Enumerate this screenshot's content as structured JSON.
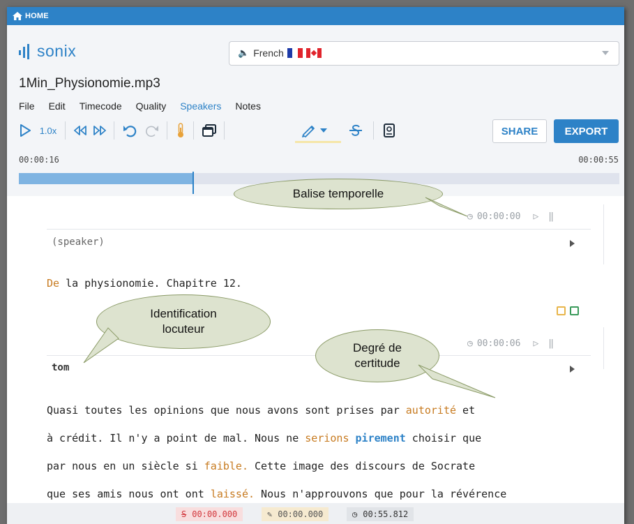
{
  "topbar": {
    "home_label": "HOME",
    "home_icon": "home-icon"
  },
  "brand": {
    "logo_text": "sonix"
  },
  "language": {
    "label": "French",
    "icon": "speaker-icon"
  },
  "file": {
    "name": "1Min_Physionomie.mp3"
  },
  "menu": {
    "items": [
      "File",
      "Edit",
      "Timecode",
      "Quality",
      "Speakers",
      "Notes"
    ]
  },
  "toolbar": {
    "speed": "1.0x",
    "share_label": "SHARE",
    "export_label": "EXPORT"
  },
  "player": {
    "current_time": "00:00:16",
    "total_time": "00:00:55",
    "progress": 0.29
  },
  "annotations": {
    "timestamp_balloon": "Balise temporelle",
    "speaker_balloon_1": "Identification",
    "speaker_balloon_2": "locuteur",
    "certainty_balloon_1": "Degré de",
    "certainty_balloon_2": "certitude"
  },
  "transcript": {
    "block1": {
      "time": "00:00:00",
      "speaker": "(speaker)",
      "text_first": "De",
      "text_rest": " la physionomie. Chapitre 12."
    },
    "block2": {
      "time": "00:00:06",
      "speaker": "tom",
      "l1a": "Quasi toutes les opinions que nous avons sont prises par ",
      "l1b": "autorité",
      "l1c": " et",
      "l2a": "à crédit. Il n'y a point de mal. Nous ne ",
      "l2b": "serions",
      "l2c": " ",
      "l2d": "pirement",
      "l2e": " choisir que",
      "l3a": "par nous en un siècle si ",
      "l3b": "faible.",
      "l3c": " Cette image des discours de Socrate",
      "l4a": "que ses amis nous ont ont ",
      "l4b": "laissé.",
      "l4c": " Nous n'approuvons que pour la révérence"
    }
  },
  "footer": {
    "strike_time": "00:00.000",
    "highlight_time": "00:00.000",
    "duration": "00:55.812"
  },
  "colors": {
    "accent": "#2d82c7",
    "uncertain": "#c77a1f",
    "strike_chip_bg": "#f8dede",
    "highlight_chip_bg": "#f6ead0",
    "duration_chip_bg": "#e1e4e8"
  }
}
